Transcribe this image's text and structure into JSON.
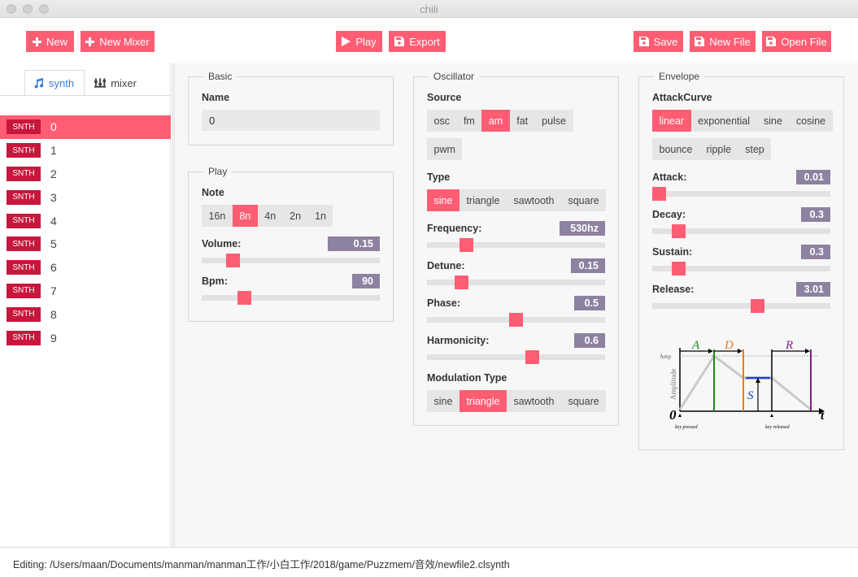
{
  "window": {
    "title": "chili"
  },
  "toolbar": {
    "new_label": "New",
    "new_mixer_label": "New Mixer",
    "play_label": "Play",
    "export_label": "Export",
    "save_label": "Save",
    "new_file_label": "New File",
    "open_file_label": "Open File"
  },
  "sidebar": {
    "tabs": [
      {
        "label": "synth",
        "icon": "music-note-icon"
      },
      {
        "label": "mixer",
        "icon": "mixer-icon"
      }
    ],
    "tracks": [
      {
        "badge": "SNTH",
        "name": "0"
      },
      {
        "badge": "SNTH",
        "name": "1"
      },
      {
        "badge": "SNTH",
        "name": "2"
      },
      {
        "badge": "SNTH",
        "name": "3"
      },
      {
        "badge": "SNTH",
        "name": "4"
      },
      {
        "badge": "SNTH",
        "name": "5"
      },
      {
        "badge": "SNTH",
        "name": "6"
      },
      {
        "badge": "SNTH",
        "name": "7"
      },
      {
        "badge": "SNTH",
        "name": "8"
      },
      {
        "badge": "SNTH",
        "name": "9"
      }
    ],
    "selected_index": 0
  },
  "basic": {
    "legend": "Basic",
    "name_label": "Name",
    "name_value": "0"
  },
  "play": {
    "legend": "Play",
    "note_label": "Note",
    "note_options": [
      "16n",
      "8n",
      "4n",
      "2n",
      "1n"
    ],
    "note_selected": "8n",
    "volume_label": "Volume:",
    "volume_value": "0.15",
    "volume_fraction": 0.15,
    "bpm_label": "Bpm:",
    "bpm_value": "90",
    "bpm_fraction": 0.22
  },
  "oscillator": {
    "legend": "Oscillator",
    "source_label": "Source",
    "source_options": [
      "osc",
      "fm",
      "am",
      "fat",
      "pulse"
    ],
    "source_options_row2": [
      "pwm"
    ],
    "source_selected": "am",
    "type_label": "Type",
    "type_options": [
      "sine",
      "triangle",
      "sawtooth",
      "square"
    ],
    "type_selected": "sine",
    "frequency_label": "Frequency:",
    "frequency_value": "530hz",
    "frequency_fraction": 0.2,
    "detune_label": "Detune:",
    "detune_value": "0.15",
    "detune_fraction": 0.17,
    "phase_label": "Phase:",
    "phase_value": "0.5",
    "phase_fraction": 0.5,
    "harmonicity_label": "Harmonicity:",
    "harmonicity_value": "0.6",
    "harmonicity_fraction": 0.6,
    "modulation_label": "Modulation Type",
    "modulation_options": [
      "sine",
      "triangle",
      "sawtooth",
      "square"
    ],
    "modulation_selected": "triangle"
  },
  "envelope": {
    "legend": "Envelope",
    "attack_curve_label": "AttackCurve",
    "curve_options": [
      "linear",
      "exponential",
      "sine",
      "cosine"
    ],
    "curve_options_row2": [
      "bounce",
      "ripple",
      "step"
    ],
    "curve_selected": "linear",
    "attack_label": "Attack:",
    "attack_value": "0.01",
    "attack_fraction": 0.0,
    "decay_label": "Decay:",
    "decay_value": "0.3",
    "decay_fraction": 0.12,
    "sustain_label": "Sustain:",
    "sustain_value": "0.3",
    "sustain_fraction": 0.12,
    "release_label": "Release:",
    "release_value": "3.01",
    "release_fraction": 0.6,
    "diagram": {
      "a": "A",
      "d": "D",
      "s": "S",
      "r": "R",
      "amp": "Amp",
      "amplitude": "Amplitude",
      "origin": "0",
      "t": "t",
      "key_pressed": "key pressed",
      "key_released": "key released",
      "colors": {
        "a": "#1a8a1a",
        "d": "#f07a10",
        "s": "#1f3fd6",
        "r": "#8a1a8a"
      }
    }
  },
  "status": {
    "editing_text": "Editing: /Users/maan/Documents/manman/manman工作/小白工作/2018/game/Puzzmem/音效/newfile2.clsynth"
  },
  "colors": {
    "accent": "#ff5d73",
    "badge": "#c8173c",
    "value_box": "#8d82a0"
  }
}
